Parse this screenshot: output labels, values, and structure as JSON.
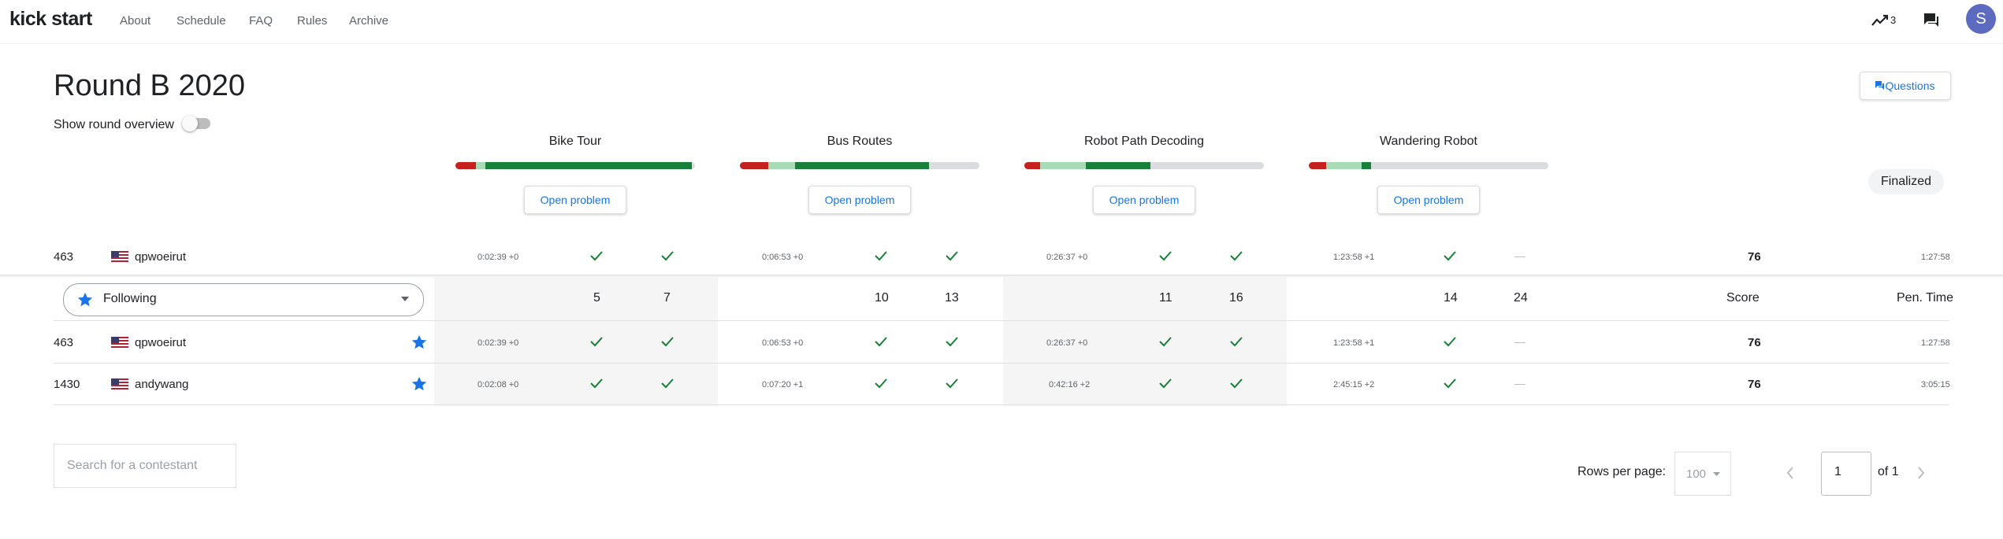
{
  "app": {
    "logo": "kick start"
  },
  "nav": [
    "About",
    "Schedule",
    "FAQ",
    "Rules",
    "Archive"
  ],
  "header_right": {
    "trend_count": "3",
    "avatar_letter": "S"
  },
  "round": {
    "title": "Round B 2020",
    "overview_label": "Show round overview",
    "questions_label": "Questions",
    "status": "Finalized"
  },
  "problems": [
    {
      "name": "Bike Tour",
      "button": "Open problem"
    },
    {
      "name": "Bus Routes",
      "button": "Open problem"
    },
    {
      "name": "Robot Path Decoding",
      "button": "Open problem"
    },
    {
      "name": "Wandering Robot",
      "button": "Open problem"
    }
  ],
  "my_row": {
    "rank": "463",
    "country": "US",
    "name": "qpwoeirut",
    "times": [
      "0:02:39 +0",
      "0:06:53 +0",
      "0:26:37 +0",
      "1:23:58 +1"
    ],
    "score": "76",
    "pen_time": "1:27:58"
  },
  "table_header": {
    "filter": "Following",
    "points": [
      [
        "5",
        "7"
      ],
      [
        "10",
        "13"
      ],
      [
        "11",
        "16"
      ],
      [
        "14",
        "24"
      ]
    ],
    "score_label": "Score",
    "pen_label": "Pen. Time"
  },
  "rows": [
    {
      "rank": "463",
      "country": "US",
      "name": "qpwoeirut",
      "times": [
        "0:02:39 +0",
        "0:06:53 +0",
        "0:26:37 +0",
        "1:23:58 +1"
      ],
      "score": "76",
      "pen_time": "1:27:58"
    },
    {
      "rank": "1430",
      "country": "US",
      "name": "andywang",
      "times": [
        "0:02:08 +0",
        "0:07:20 +1",
        "0:42:16 +2",
        "2:45:15 +2"
      ],
      "score": "76",
      "pen_time": "3:05:15"
    }
  ],
  "footer": {
    "search_placeholder": "Search for a contestant",
    "rows_per_page_label": "Rows per page:",
    "rows_per_page": "100",
    "page": "1",
    "of_label": "of 1"
  },
  "colors": {
    "accent": "#1a73e8",
    "success": "#188038",
    "wrong": "#c5221f",
    "partial": "#a8dab5"
  }
}
